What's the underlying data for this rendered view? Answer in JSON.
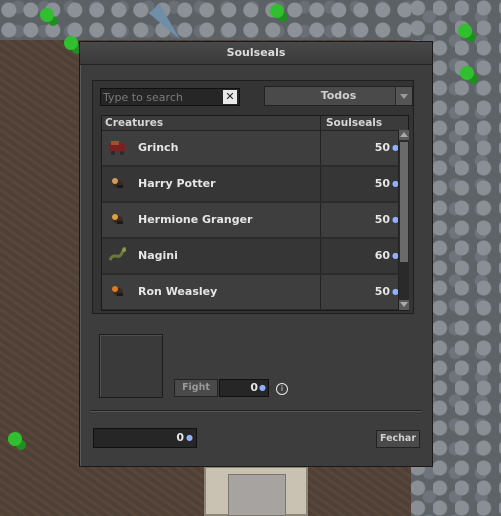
{
  "window": {
    "title": "Soulseals"
  },
  "search": {
    "placeholder": "Type to search",
    "value": "",
    "clear_icon": "x-icon"
  },
  "filter": {
    "selected": "Todos"
  },
  "table": {
    "headers": {
      "creature": "Creatures",
      "soulseals": "Soulseals"
    },
    "rows": [
      {
        "name": "Grinch",
        "soulseals": "50",
        "icon": "grinch-icon"
      },
      {
        "name": "Harry Potter",
        "soulseals": "50",
        "icon": "harry-potter-icon"
      },
      {
        "name": "Hermione Granger",
        "soulseals": "50",
        "icon": "hermione-granger-icon"
      },
      {
        "name": "Nagini",
        "soulseals": "60",
        "icon": "nagini-icon"
      },
      {
        "name": "Ron Weasley",
        "soulseals": "50",
        "icon": "ron-weasley-icon"
      }
    ]
  },
  "fight": {
    "label": "Fight",
    "amount": "0",
    "coin_icon": "soulseal-coin-icon"
  },
  "balance": {
    "value": "0"
  },
  "close": {
    "label": "Fechar"
  },
  "colors": {
    "window_bg": "#3d3d3d",
    "row_alt": "#3e3e3e",
    "coin": "#8fb0ff"
  }
}
